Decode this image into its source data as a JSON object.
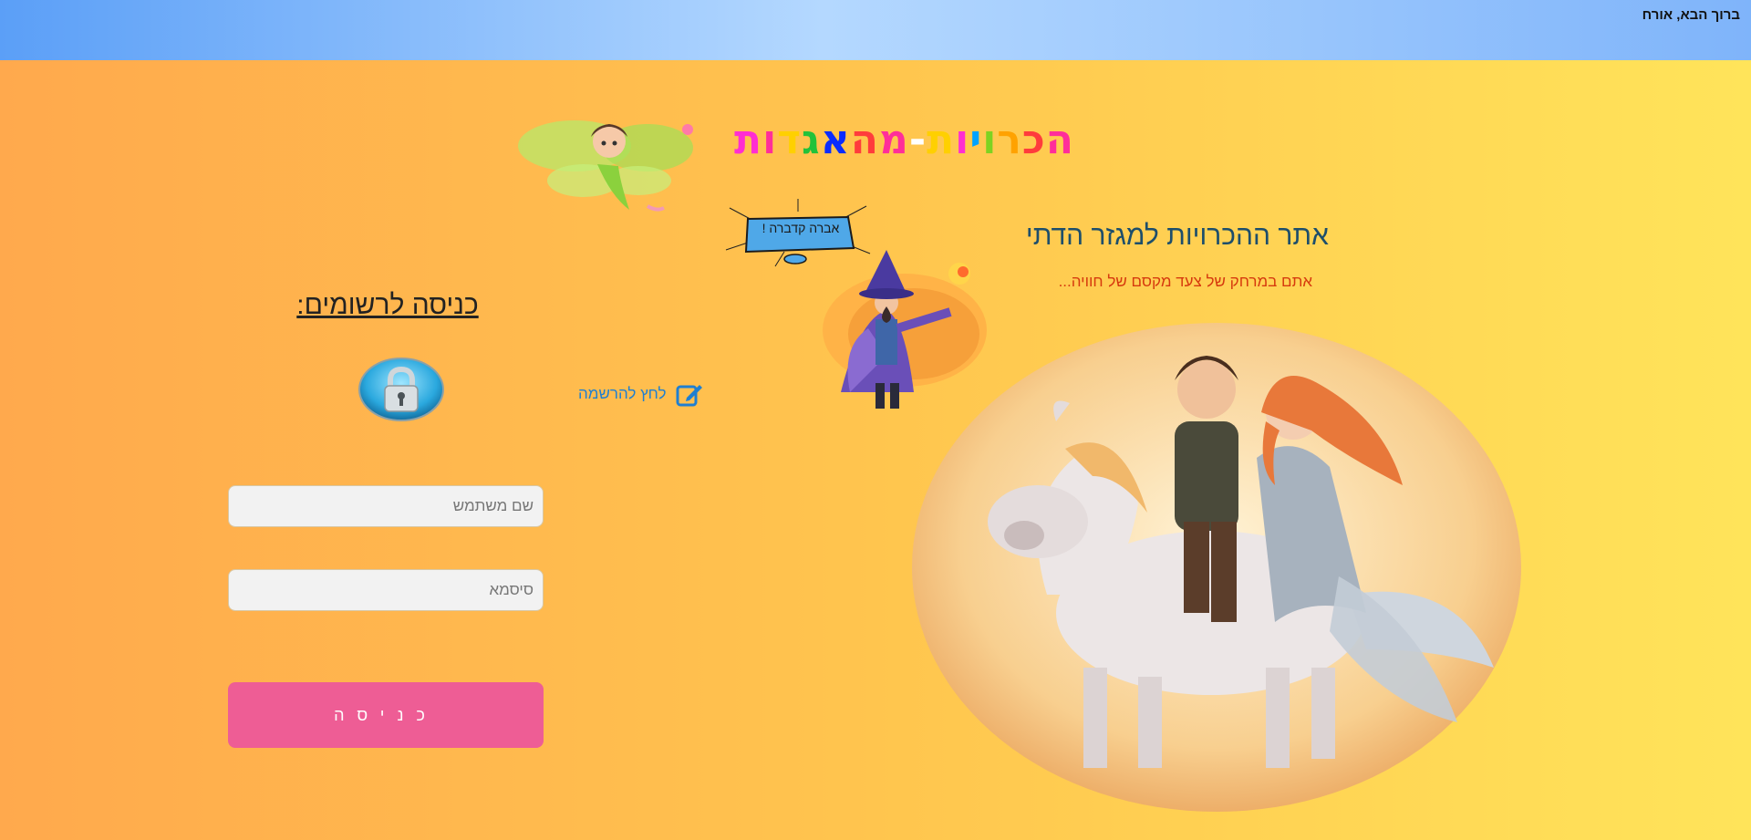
{
  "header": {
    "greeting": "ברוך הבא, אורח"
  },
  "title": {
    "letters": [
      "ה",
      "כ",
      "ר",
      "ו",
      "י",
      "ו",
      "ת",
      "-",
      "מ",
      "ה",
      "א",
      "ג",
      "ד",
      "ו",
      "ת"
    ],
    "colors": [
      "#ff2e9a",
      "#ff3c3c",
      "#ffa200",
      "#7ed321",
      "#00a3ff",
      "#ff2ed2",
      "#ffd000",
      "#ffffff",
      "#ff2e9a",
      "#ff3c3c",
      "#0a2cff",
      "#22c23a",
      "#ffd000",
      "#ff2e9a",
      "#ff2ed2"
    ]
  },
  "hero": {
    "subtitle": "אתר ההכרויות למגזר הדתי",
    "tagline": "אתם במרחק של צעד מקסם של חוויה...",
    "speech_bubble": "אברה קדברה !"
  },
  "login": {
    "heading": "כניסה לרשומים:",
    "username_placeholder": "שם משתמש",
    "username_value": "",
    "password_placeholder": "סיסמא",
    "password_value": "",
    "submit_label": "כניסה"
  },
  "register": {
    "link_label": "לחץ להרשמה"
  },
  "colors": {
    "accent_pink": "#ee5d95",
    "link_blue": "#1f7fd1",
    "subtitle": "#1d4e6b",
    "tagline": "#d63a0e"
  },
  "icons": {
    "lock": "padlock-icon",
    "edit": "edit-icon"
  }
}
